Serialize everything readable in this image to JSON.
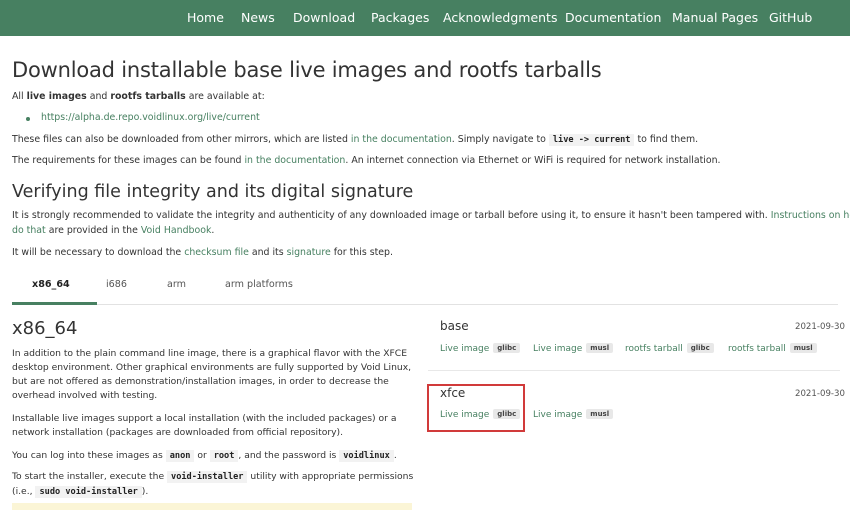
{
  "nav": {
    "items": [
      "Home",
      "News",
      "Download",
      "Packages",
      "Acknowledgments",
      "Documentation",
      "Manual Pages",
      "GitHub"
    ]
  },
  "header": {
    "title": "Download installable base live images and rootfs tarballs"
  },
  "intro": {
    "all_prefix": "All ",
    "live_images": "live images",
    "and": " and ",
    "rootfs_tarballs": "rootfs tarballs",
    "available_suffix": " are available at:",
    "mirror_url": "https://alpha.de.repo.voidlinux.org/live/current",
    "mirrors_text_1": "These files can also be downloaded from other mirrors, which are listed ",
    "mirrors_link": "in the documentation",
    "mirrors_text_2": ". Simply navigate to ",
    "mirrors_code": "live -> current",
    "mirrors_text_3": " to find them.",
    "req_text_1": "The requirements for these images can be found ",
    "req_link": "in the documentation",
    "req_text_2": ". An internet connection via Ethernet or WiFi is required for network installation."
  },
  "verify": {
    "title": "Verifying file integrity and its digital signature",
    "p1_text": "It is strongly recommended to validate the integrity and authenticity of any downloaded image or tarball before using it, to ensure it hasn't been tampered with. ",
    "p1_link_1": "Instructions on how to",
    "p1_link_2": "do that",
    "p1_text_2": " are provided in the ",
    "p1_link_3": "Void Handbook",
    "p1_end": ".",
    "p2_text_1": "It will be necessary to download the ",
    "p2_link_1": "checksum file",
    "p2_text_2": " and its ",
    "p2_link_2": "signature",
    "p2_text_3": " for this step."
  },
  "tabs": [
    "x86_64",
    "i686",
    "arm",
    "arm platforms"
  ],
  "arch": {
    "title": "x86_64",
    "p1": "In addition to the plain command line image, there is a graphical flavor with the XFCE desktop environment. Other graphical environments are fully supported by Void Linux, but are not offered as demonstration/installation images, in order to decrease the overhead involved with testing.",
    "p2": "Installable live images support a local installation (with the included packages) or a network installation (packages are downloaded from official repository).",
    "login_1": "You can log into these images as ",
    "login_code_1": "anon",
    "login_2": " or ",
    "login_code_2": "root",
    "login_3": ", and the password is ",
    "login_code_3": "voidlinux",
    "login_4": ".",
    "start_1": "To start the installer, execute the ",
    "start_code": "void-installer",
    "start_2": " utility with appropriate permissions",
    "start_3": "(i.e., ",
    "start_code_2": "sudo void-installer",
    "start_4": ")."
  },
  "downloads": {
    "base": {
      "title": "base",
      "date": "2021-09-30",
      "links": [
        {
          "label": "Live image",
          "badge": "glibc"
        },
        {
          "label": "Live image",
          "badge": "musl"
        },
        {
          "label": "rootfs tarball",
          "badge": "glibc"
        },
        {
          "label": "rootfs tarball",
          "badge": "musl"
        }
      ]
    },
    "xfce": {
      "title": "xfce",
      "date": "2021-09-30",
      "links": [
        {
          "label": "Live image",
          "badge": "glibc"
        },
        {
          "label": "Live image",
          "badge": "musl"
        }
      ]
    }
  },
  "colors": {
    "nav_bg": "#478061",
    "link": "#478061",
    "highlight_border": "#d13a3a"
  }
}
